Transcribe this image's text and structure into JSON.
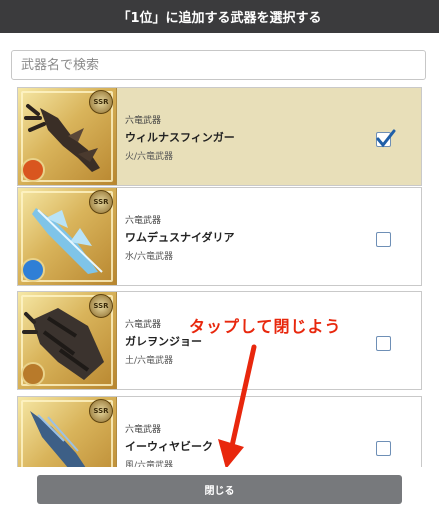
{
  "header": {
    "title": "「1位」に追加する武器を選択する"
  },
  "search": {
    "placeholder": "武器名で検索",
    "value": ""
  },
  "items": [
    {
      "category": "六竜武器",
      "name": "ウィルナスフィンガー",
      "type": "火/六竜武器",
      "rarity": "SSR",
      "element_color": "#d9561f",
      "selected": true
    },
    {
      "category": "六竜武器",
      "name": "ワムデュスナイダリア",
      "type": "水/六竜武器",
      "rarity": "SSR",
      "element_color": "#2f7fd6",
      "selected": false
    },
    {
      "category": "六竜武器",
      "name": "ガレヲンジョー",
      "type": "土/六竜武器",
      "rarity": "SSR",
      "element_color": "#b87a2a",
      "selected": false
    },
    {
      "category": "六竜武器",
      "name": "イーウィヤビーク",
      "type": "風/六竜武器",
      "rarity": "SSR",
      "element_color": "#3ea04a",
      "selected": false
    }
  ],
  "annotation": {
    "text": "タップして閉じよう",
    "color": "#e8270d"
  },
  "footer": {
    "close_label": "閉じる"
  }
}
